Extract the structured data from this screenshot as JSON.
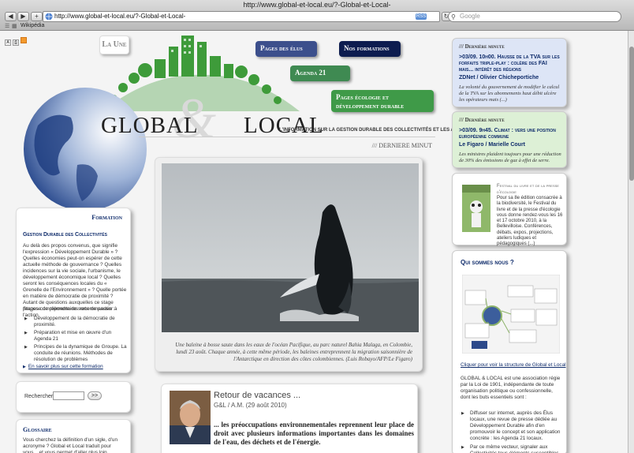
{
  "browser": {
    "title": "http://www.global-et-local.eu/?-Global-et-Local-",
    "url": "http://www.global-et-local.eu/?-Global-et-Local-",
    "search_placeholder": "Google",
    "bookmark": "Wikipédia"
  },
  "header": {
    "home_label": "La Une",
    "nav": {
      "elus": "Pages des élus",
      "formations": "Nos formations",
      "agenda": "Agenda 21",
      "ecologie": "Pages écologie et développement durable"
    },
    "logo_global": "GLOBAL",
    "logo_amp": "&",
    "logo_local": "LOCAL",
    "tagline": "L'INFORMATION SUR LA GESTION DURABLE DES COLLECTIVITÉS  ET LES AGENDA 21",
    "news_strip": "/// DERNIERE MINUT"
  },
  "main": {
    "photo_caption": "Une baleine à bosse saute dans les eaux de l'océan Pacifique, au parc naturel Bahia Malaga, en Colombie, lundi 23 août. Chaque année, à cette même période, les baleines entreprennent la migration saisonnière de l'Antarctique en direction des côtes colombiennes. (Luis Robayo/AFP/Le Figaro)",
    "article": {
      "title": "Retour de vacances ...",
      "meta": "G&L / A.M. (29 août 2010)",
      "body": "... les préoccupations environnementales reprennent leur place de droit avec plusieurs informations importantes dans les domaines de l'eau, des déchets et de l'énergie."
    }
  },
  "left": {
    "formation": {
      "heading": "Formation",
      "subheading": "Gestion Durable des Collectivités",
      "intro": "Au delà des propos convenus, que signifie l'expression « Développement Durable » ? Quelles économies peut-on espérer de cette actuelle méthode de gouvernance ? Quelles incidences sur la vie sociale, l'urbanisme, le développement économique local ? Quelles seront les conséquences locales du « Grenelle de l'Environnement » ? Quelle portée en matière de démocratie de proximité ? Autant de questions auxquelles ce stage propose de répondre de sorte de passer à l'action.",
      "stages_label": "Stages complémentaires recommandés :",
      "stages": [
        "Développement de la démocratie de proximité.",
        "Préparation et mise en œuvre d'un Agenda 21",
        "Principes de la dynamique de Groupe. La conduite de réunions. Méthodes de résolution de problèmes"
      ],
      "more_link": "En savoir plus sur cette formation"
    },
    "search": {
      "label": "Rechercher :",
      "value": "",
      "button": ">>"
    },
    "glossary": {
      "heading": "Glossaire",
      "text": "Vous cherchez la définition d'un sigle, d'un acronyme ? Global et Local traduit pour vous... et vous permet d'aller plus loin."
    }
  },
  "right": {
    "news1": {
      "head": "/// Dernière minute",
      "title": ">03/09. 10h00. Hausse de la TVA sur les forfaits triple-play : colère des FAI mais... intérêt des régions",
      "source": "ZDNet / Olivier Chicheportiche",
      "text": "La volonté du gouvernement de modifier le calcul de la TVA sur les abonnements haut débit ulcère les opérateurs mais (...)"
    },
    "news2": {
      "head": "/// Dernière minute",
      "title": ">03/09. 9h45. Climat : vers une position européenne commune",
      "source": "Le Figaro / Marielle Court",
      "text": "Les ministres plaident toujours pour une réduction de 30% des émissions de gaz à effet de serre."
    },
    "festival": {
      "title": "Festival du livre et de la presse d'écologie",
      "text": "Pour sa 8e édition consacrée à la biodiversité, le Festival du livre et de la presse d'écologie vous donne rendez-vous les 16 et 17 octobre 2010, à la Bellevilloise. Conférences, débats, expos, projections, ateliers ludiques et pédagogiques (...)"
    },
    "who": {
      "heading": "Qui sommes nous ?",
      "link": "Cliquer pour voir la structure de Global et Local",
      "text": "GLOBAL & LOCAL est une association régie par la Loi de 1901, indépendante de toute organisation politique ou confessionnelle, dont les buts essentiels sont :",
      "goals": [
        "Diffuser sur internet, auprès des Élus locaux, une revue de presse dédiée au Développement Durable afin d'en promouvoir le concept et son application concrète : les Agenda 21 locaux.",
        "Par ce même vecteur, signaler aux Collectivités tous éléments susceptibles"
      ]
    }
  },
  "colors": {
    "nav_elus": "#3c4f8c",
    "nav_formations": "#0d1c4f",
    "nav_agenda": "#3f8a52",
    "nav_ecologie": "#3f9a48",
    "news1_bg": "#dde5f6",
    "news2_bg": "#ddf0d6",
    "link": "#0f2c6b"
  }
}
